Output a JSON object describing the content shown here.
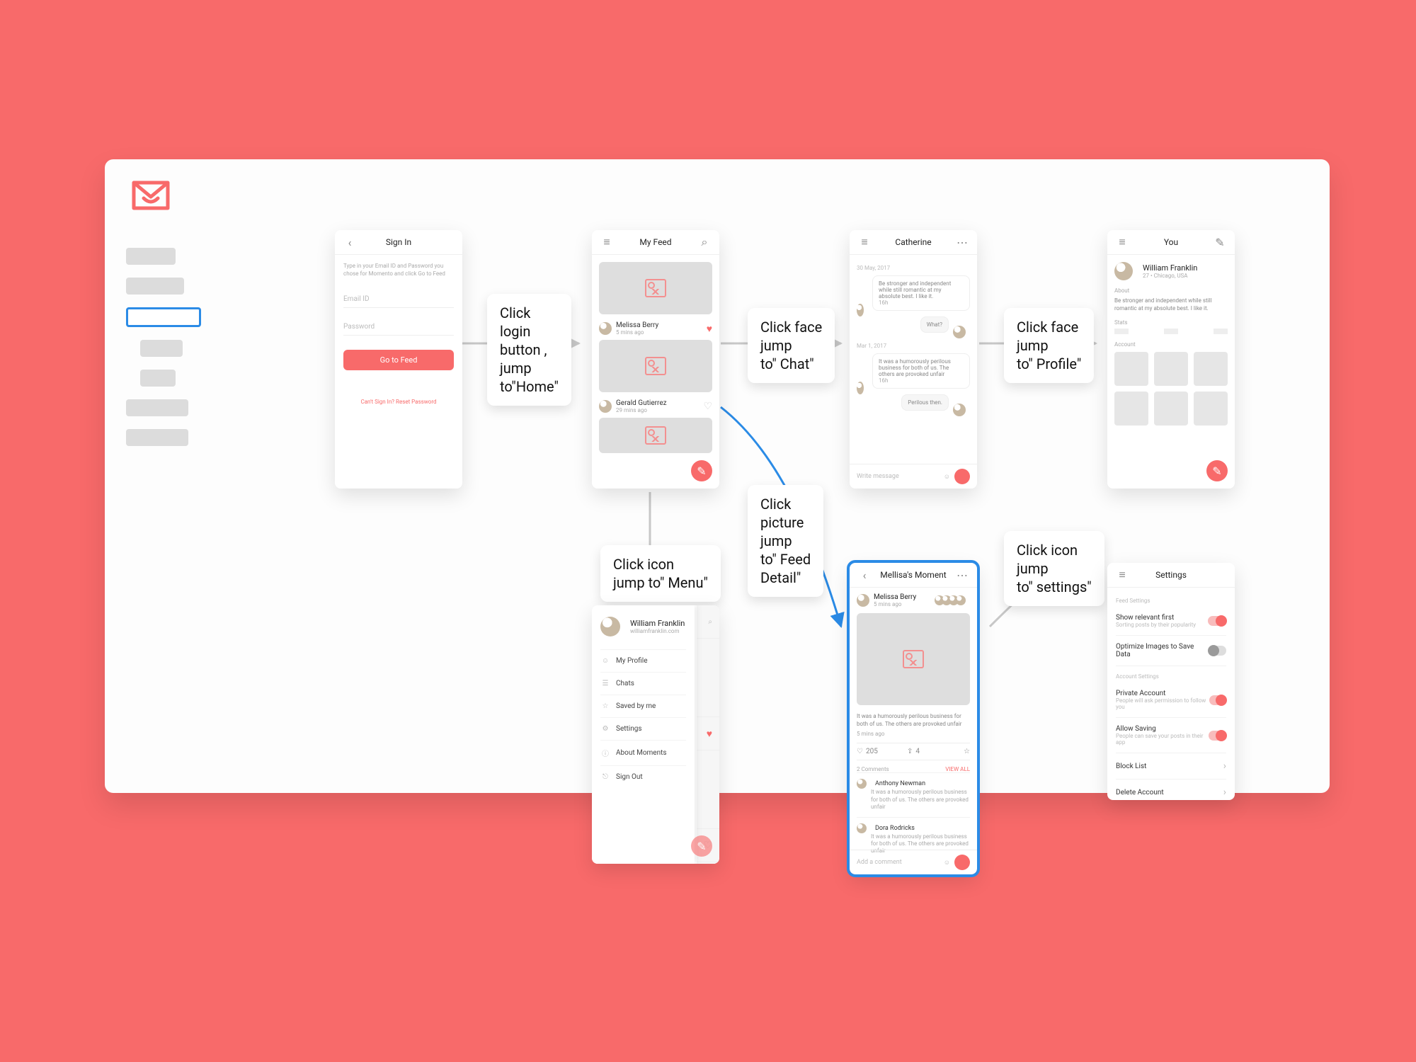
{
  "background_color": "#f86a6a",
  "accent": "#f86a6a",
  "selection_color": "#2b8be6",
  "labels": {
    "l1": "Click\nlogin\nbutton ,\njump\nto\"Home\"",
    "l2": "Click face\njump\nto\" Chat\"",
    "l3": "Click face\njump\nto\" Profile\"",
    "l4": "Click icon\njump to\" Menu\"",
    "l5": "Click\npicture\njump\nto\" Feed\nDetail\"",
    "l6": "Click icon\njump\nto\" settings\""
  },
  "screens": {
    "signin": {
      "title": "Sign In",
      "intro": "Type in your Email ID and Password you chose for Momento and click Go to Feed",
      "email_placeholder": "Email ID",
      "password_placeholder": "Password",
      "cta": "Go to Feed",
      "footer": "Can't Sign In? Reset Password"
    },
    "feed": {
      "title": "My Feed",
      "posts": [
        {
          "name": "Melissa Berry",
          "time": "5 mins ago",
          "liked": true
        },
        {
          "name": "Gerald Gutierrez",
          "time": "29 mins ago",
          "liked": false
        }
      ]
    },
    "chat": {
      "title": "Catherine",
      "date1": "30 May, 2017",
      "msg1": "Be stronger and independent while still romantic at my absolute best. I like it.",
      "ago1": "16h",
      "reply1": "What?",
      "date2": "Mar 1, 2017",
      "msg2": "It was a humorously perilous business for both of us. The others are provoked unfair",
      "ago2": "16h",
      "reply2": "Perilous then.",
      "input_placeholder": "Write message"
    },
    "profile": {
      "title": "You",
      "name": "William Franklin",
      "meta": "27 • Chicago, USA",
      "about_hdr": "About",
      "about": "Be stronger and independent while still romantic at my absolute best. I like it.",
      "stats_hdr": "Stats",
      "grid_hdr": "Account"
    },
    "menu": {
      "name": "William Franklin",
      "sub": "williamfranklin.com",
      "items": [
        "My Profile",
        "Chats",
        "Saved by me",
        "Settings",
        "About Moments",
        "Sign Out"
      ]
    },
    "detail": {
      "title": "Mellisa's Moment",
      "author": "Melissa Berry",
      "time": "5 mins ago",
      "caption": "It was a humorously perilous business for both of us. The others are provoked unfair",
      "ago": "5 mins ago",
      "likes": "205",
      "shares": "4",
      "comments_hdr": "2 Comments",
      "view_all": "VIEW ALL",
      "comments": [
        {
          "name": "Anthony Newman",
          "text": "It was a humorously perilous business for both of us. The others are provoked unfair"
        },
        {
          "name": "Dora Rodricks",
          "text": "It was a humorously perilous business for both of us. The others are provoked unfair"
        }
      ],
      "input_placeholder": "Add a comment"
    },
    "settings": {
      "title": "Settings",
      "hdr1": "Feed Settings",
      "hdr2": "Account Settings",
      "items": [
        {
          "t": "Show relevant first",
          "s": "Sorting posts by their popularity",
          "on": true
        },
        {
          "t": "Optimize Images to Save Data",
          "s": "",
          "on": false
        },
        {
          "t": "Private Account",
          "s": "People will ask permission to follow you",
          "on": true
        },
        {
          "t": "Allow Saving",
          "s": "People can save your posts in their app",
          "on": true
        },
        {
          "t": "Block List",
          "s": "",
          "chev": true
        },
        {
          "t": "Delete Account",
          "s": "",
          "chev": true
        }
      ]
    }
  }
}
